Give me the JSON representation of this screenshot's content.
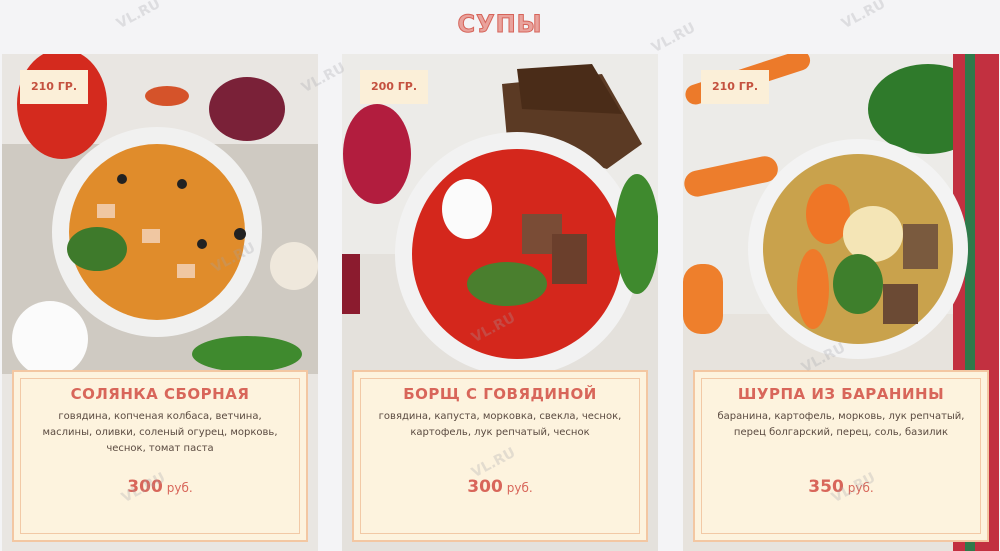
{
  "page": {
    "title": "СУПЫ",
    "watermark_text": "VL.RU"
  },
  "colors": {
    "accent": "#d8665a",
    "card_bg": "#fdf3de",
    "card_border": "#f3c7a2",
    "badge_bg": "#fbefd8"
  },
  "dishes": [
    {
      "weight": "210 ГР.",
      "name": "СОЛЯНКА СБОРНАЯ",
      "description": "говядина, копченая колбаса, ветчина, маслины, оливки, соленый огурец, морковь, чеснок, томат паста",
      "price": "300",
      "currency": "руб."
    },
    {
      "weight": "200 ГР.",
      "name": "БОРЩ С ГОВЯДИНОЙ",
      "description": "говядина, капуста, морковка, свекла, чеснок, картофель, лук репчатый, чеснок",
      "price": "300",
      "currency": "руб."
    },
    {
      "weight": "210 ГР.",
      "name": "ШУРПА ИЗ БАРАНИНЫ",
      "description": "баранина, картофель, морковь, лук репчатый, перец болгарский, перец, соль, базилик",
      "price": "350",
      "currency": "руб."
    }
  ]
}
